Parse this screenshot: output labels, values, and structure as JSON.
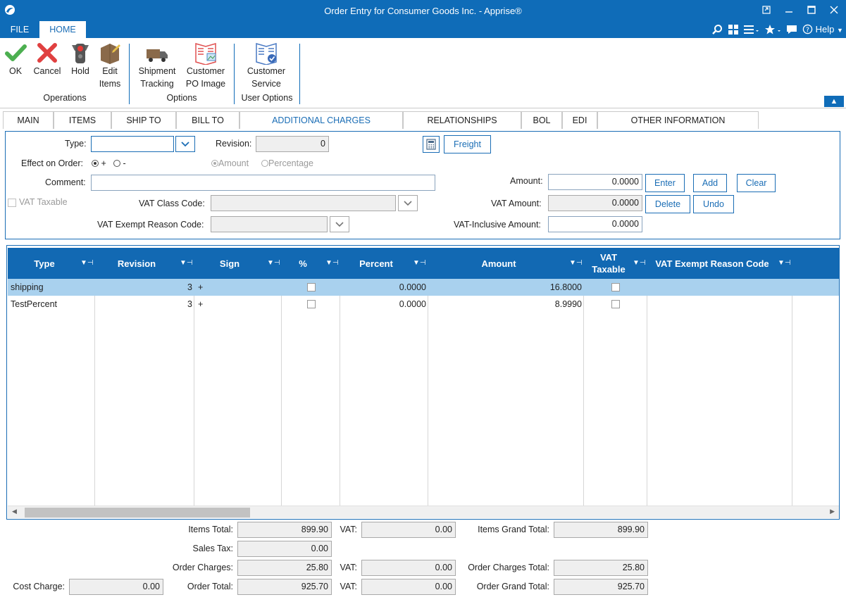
{
  "window": {
    "title": "Order Entry for Consumer Goods Inc. - Apprise®"
  },
  "menu": {
    "file": "FILE",
    "home": "HOME",
    "help": "Help"
  },
  "ribbon": {
    "ok": "OK",
    "cancel": "Cancel",
    "hold": "Hold",
    "edit_items_1": "Edit",
    "edit_items_2": "Items",
    "group_operations": "Operations",
    "shipment_1": "Shipment",
    "shipment_2": "Tracking",
    "customer_po_1": "Customer",
    "customer_po_2": "PO Image",
    "group_options": "Options",
    "customer_service_1": "Customer",
    "customer_service_2": "Service",
    "group_user_options": "User Options"
  },
  "tabs": [
    "MAIN",
    "ITEMS",
    "SHIP TO",
    "BILL TO",
    "ADDITIONAL CHARGES",
    "RELATIONSHIPS",
    "BOL",
    "EDI",
    "OTHER INFORMATION"
  ],
  "form": {
    "type_label": "Type:",
    "type_value": "",
    "revision_label": "Revision:",
    "revision_value": "0",
    "freight_button": "Freight",
    "effect_label": "Effect on Order:",
    "effect_plus": "+",
    "effect_minus": "-",
    "amount_radio": "Amount",
    "percentage_radio": "Percentage",
    "comment_label": "Comment:",
    "comment_value": "",
    "amount_label": "Amount:",
    "amount_value": "0.0000",
    "enter_button": "Enter",
    "add_button": "Add",
    "clear_button": "Clear",
    "vat_taxable_label": "VAT Taxable",
    "vat_class_label": "VAT Class Code:",
    "vat_amount_label": "VAT Amount:",
    "vat_amount_value": "0.0000",
    "delete_button": "Delete",
    "undo_button": "Undo",
    "vat_exempt_label": "VAT Exempt Reason Code:",
    "vat_inclusive_label": "VAT-Inclusive Amount:",
    "vat_inclusive_value": "0.0000"
  },
  "grid": {
    "headers": {
      "type": "Type",
      "revision": "Revision",
      "sign": "Sign",
      "pct": "%",
      "percent": "Percent",
      "amount": "Amount",
      "vat_taxable_1": "VAT",
      "vat_taxable_2": "Taxable",
      "vat_exempt": "VAT Exempt Reason Code"
    },
    "rows": [
      {
        "type": "shipping",
        "revision": "3",
        "sign": "+",
        "percent": "0.0000",
        "amount": "16.8000"
      },
      {
        "type": "TestPercent",
        "revision": "3",
        "sign": "+",
        "percent": "0.0000",
        "amount": "8.9990"
      }
    ]
  },
  "totals": {
    "items_total_label": "Items Total:",
    "items_total": "899.90",
    "vat_label": "VAT:",
    "items_vat": "0.00",
    "items_grand_label": "Items Grand Total:",
    "items_grand": "899.90",
    "sales_tax_label": "Sales Tax:",
    "sales_tax": "0.00",
    "order_charges_label": "Order Charges:",
    "order_charges": "25.80",
    "charges_vat": "0.00",
    "order_charges_total_label": "Order Charges Total:",
    "order_charges_total": "25.80",
    "cost_charge_label": "Cost Charge:",
    "cost_charge": "0.00",
    "order_total_label": "Order Total:",
    "order_total": "925.70",
    "order_vat": "0.00",
    "order_grand_label": "Order Grand Total:",
    "order_grand": "925.70"
  }
}
